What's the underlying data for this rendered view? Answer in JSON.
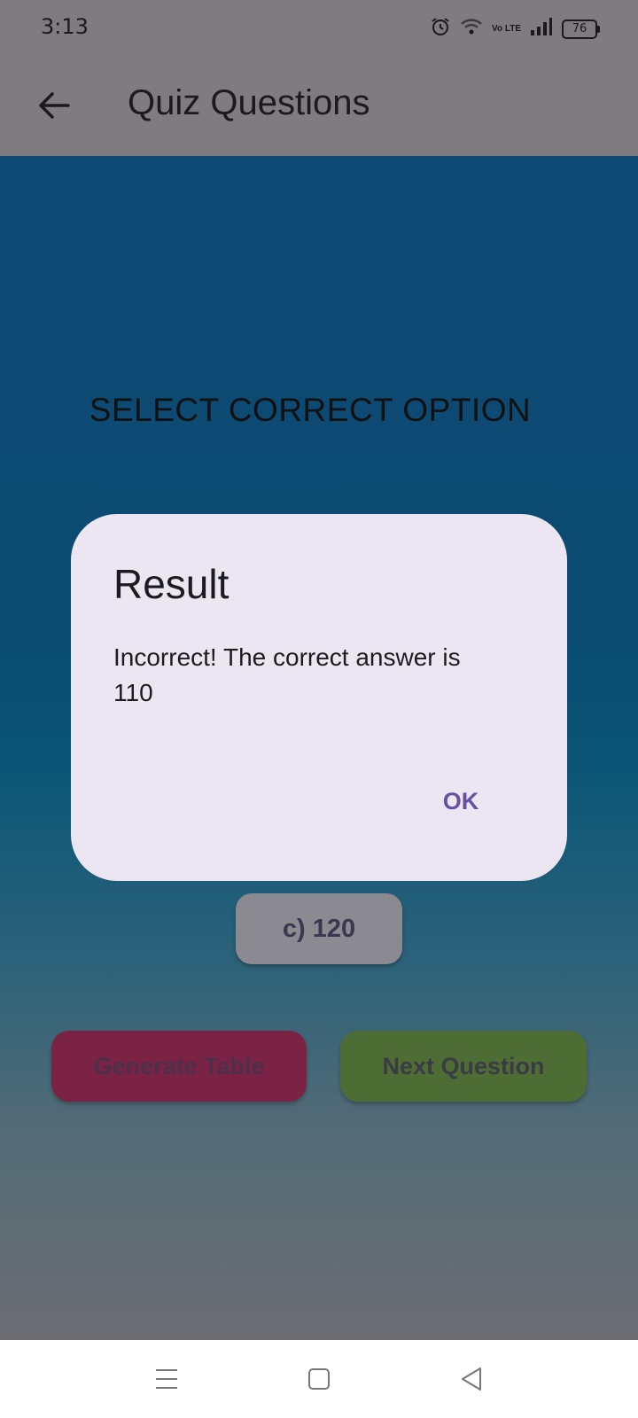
{
  "status_bar": {
    "time": "3:13",
    "volte": "Vo LTE",
    "battery": "76",
    "icons": [
      "alarm-icon",
      "wifi-icon",
      "volte-icon",
      "signal-icon",
      "battery-icon"
    ]
  },
  "app_bar": {
    "title": "Quiz Questions",
    "back_icon": "arrow-back-icon"
  },
  "quiz": {
    "heading": "SELECT CORRECT OPTION",
    "option_c": "c) 120"
  },
  "actions": {
    "generate_label": "Generate Table",
    "next_label": "Next Question"
  },
  "dialog": {
    "title": "Result",
    "message": "Incorrect! The correct answer is 110",
    "ok_label": "OK"
  },
  "nav_bar": {
    "icons": [
      "menu-icon",
      "home-icon",
      "back-icon"
    ]
  },
  "colors": {
    "scrim": "#7f7b80",
    "dialog_bg": "#ece6f2",
    "accent": "#6750a4",
    "generate_btn": "#7b2344",
    "next_btn": "#4d6d34"
  }
}
